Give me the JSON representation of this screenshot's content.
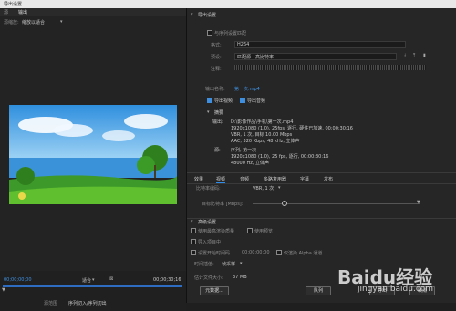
{
  "window": {
    "title": "导出设置"
  },
  "left_panel": {
    "tabs": [
      "源",
      "输出"
    ],
    "source_scaling_label": "源缩放:",
    "source_scaling_value": "缩放以适合",
    "timecode_start": "00;00;00;00",
    "timecode_end": "00;00;30;16",
    "fit_label": "适合",
    "source_range_label": "源范围",
    "source_range_value": "序列切入/序列切出"
  },
  "export_settings": {
    "section_title": "导出设置",
    "match_sequence_label": "与序列设置匹配",
    "format_label": "格式:",
    "format_value": "H264",
    "preset_label": "预设:",
    "preset_value": "匹配源 - 高比特率",
    "comments_label": "注释:",
    "output_name_label": "输出名称:",
    "output_name_value": "第一次.mp4",
    "export_video_label": "导出视频",
    "export_audio_label": "导出音频",
    "summary_title": "摘要",
    "summary_output_label": "输出:",
    "summary_output_lines": [
      "D:\\影像作品\\手机\\第一次.mp4",
      "1920x1080 (1.0), 25fps, 逐行, 硬件已加速, 00:00:30:16",
      "VBR, 1 次, 目标 10.00 Mbps",
      "AAC, 320 Kbps, 48 kHz, 立体声"
    ],
    "summary_source_label": "源:",
    "summary_source_lines": [
      "序列, 第一次",
      "1920x1080 (1.0), 25 fps, 逐行, 00:00:30:16",
      "48000 Hz, 立体声"
    ]
  },
  "right_tabs": [
    "效果",
    "视频",
    "音频",
    "多路复用器",
    "字幕",
    "发布"
  ],
  "video_settings": {
    "bitrate_encoding_label": "比特率编码:",
    "bitrate_encoding_value": "VBR, 1 次",
    "target_bitrate_label": "目标比特率 [Mbps]:"
  },
  "advanced": {
    "section_title": "高级设置",
    "max_render_quality": "使用最高渲染质量",
    "use_previews": "使用预览",
    "import_into_project": "导入项目中",
    "set_start_timecode": "设置开始时间码",
    "start_timecode_value": "00;00;00;00",
    "render_alpha": "仅渲染 Alpha 通道",
    "interpolation_label": "时间插值:",
    "interpolation_value": "帧采样",
    "file_size_label": "估计文件大小:",
    "file_size_value": "37 MB"
  },
  "buttons": {
    "metadata": "元数据...",
    "queue": "队列",
    "export": "导出",
    "cancel": "取消"
  },
  "watermark": {
    "text": "Baidu经验",
    "url": "jingyan.baidu.com"
  },
  "colors": {
    "accent": "#2d8ceb",
    "sky": "#4aa8e8",
    "grass": "#3d9a2a",
    "water": "#2f86cf"
  }
}
